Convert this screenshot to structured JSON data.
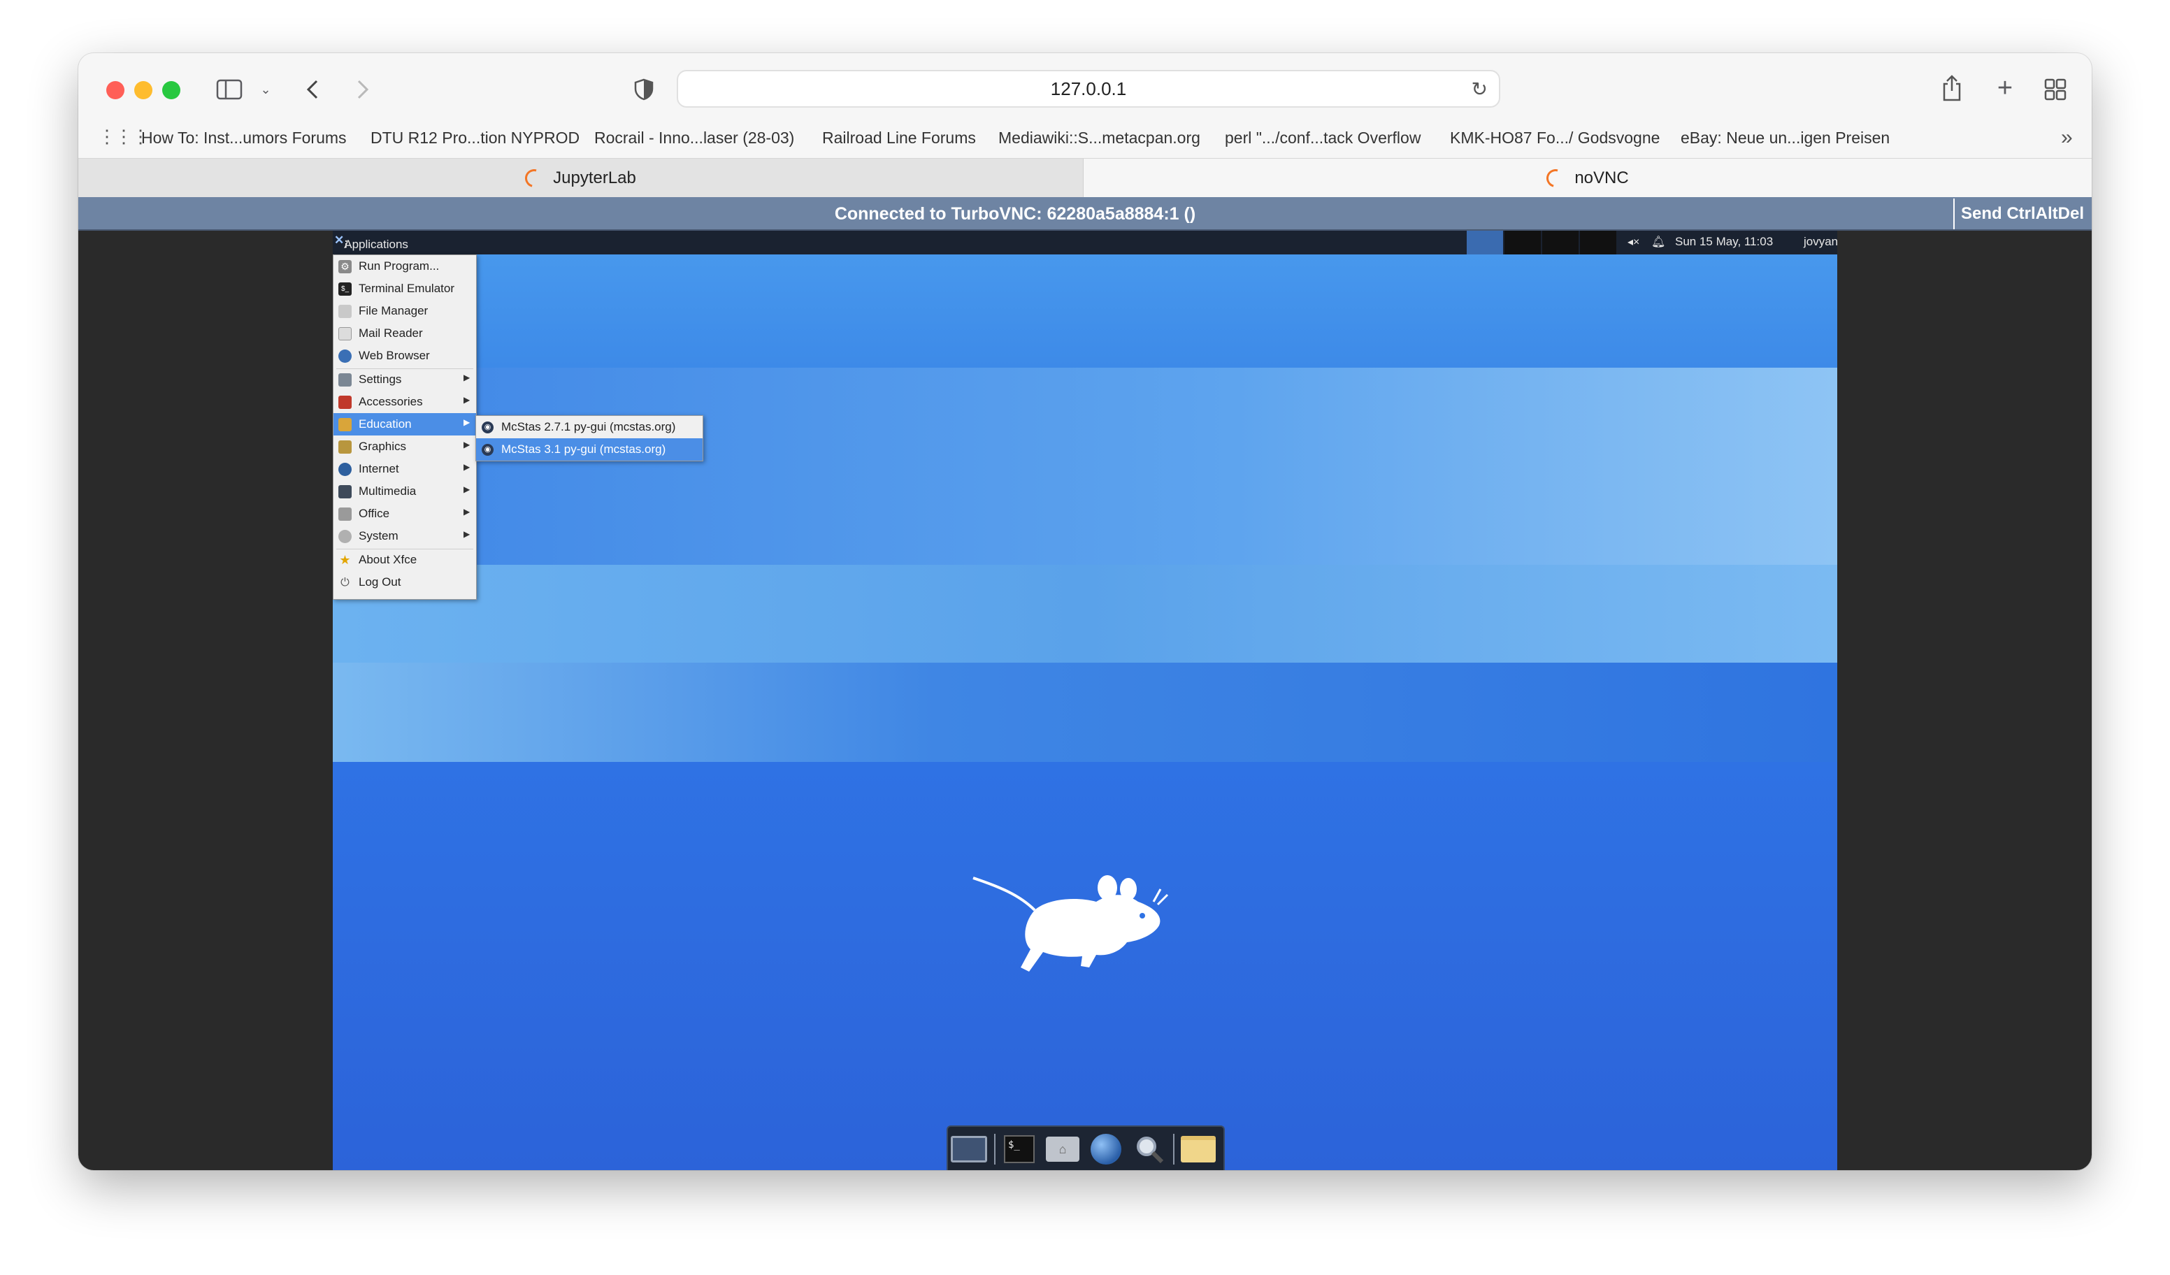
{
  "browser": {
    "url": "127.0.0.1",
    "bookmarks": [
      "How To: Inst...umors Forums",
      "DTU R12 Pro...tion NYPROD",
      "Rocrail - Inno...laser (28-03)",
      "Railroad Line Forums",
      "Mediawiki::S...metacpan.org",
      "perl \".../conf...tack Overflow",
      "KMK-HO87 Fo.../ Godsvogne",
      "eBay: Neue un...igen Preisen"
    ],
    "tabs": [
      {
        "label": "JupyterLab",
        "active": false
      },
      {
        "label": "noVNC",
        "active": true
      }
    ]
  },
  "vnc": {
    "status": "Connected to TurboVNC: 62280a5a8884:1 ()",
    "send_button": "Send CtrlAltDel"
  },
  "xfce": {
    "panel": {
      "apps_label": "Applications",
      "clock": "Sun 15 May, 11:03",
      "user": "jovyan"
    },
    "menu": [
      {
        "label": "Run Program...",
        "icon": "run-icon",
        "submenu": false
      },
      {
        "label": "Terminal Emulator",
        "icon": "terminal-icon",
        "submenu": false
      },
      {
        "label": "File Manager",
        "icon": "file-manager-icon",
        "submenu": false
      },
      {
        "label": "Mail Reader",
        "icon": "mail-icon",
        "submenu": false
      },
      {
        "label": "Web Browser",
        "icon": "globe-icon",
        "submenu": false
      },
      {
        "label": "Settings",
        "icon": "settings-icon",
        "submenu": true
      },
      {
        "label": "Accessories",
        "icon": "accessories-icon",
        "submenu": true
      },
      {
        "label": "Education",
        "icon": "education-icon",
        "submenu": true,
        "highlighted": true
      },
      {
        "label": "Graphics",
        "icon": "graphics-icon",
        "submenu": true
      },
      {
        "label": "Internet",
        "icon": "internet-icon",
        "submenu": true
      },
      {
        "label": "Multimedia",
        "icon": "multimedia-icon",
        "submenu": true
      },
      {
        "label": "Office",
        "icon": "office-icon",
        "submenu": true
      },
      {
        "label": "System",
        "icon": "system-icon",
        "submenu": true
      },
      {
        "label": "About Xfce",
        "icon": "star-icon",
        "submenu": false
      },
      {
        "label": "Log Out",
        "icon": "logout-icon",
        "submenu": false
      }
    ],
    "submenu": [
      {
        "label": "McStas 2.7.1 py-gui (mcstas.org)",
        "highlighted": false
      },
      {
        "label": "McStas 3.1 py-gui (mcstas.org)",
        "highlighted": true
      }
    ]
  },
  "colors": {
    "desktop": "#2f72e4",
    "menu_highlight": "#4b8ee6",
    "vnc_bar": "#6e84a3",
    "tab_spinner": "#f37626"
  }
}
